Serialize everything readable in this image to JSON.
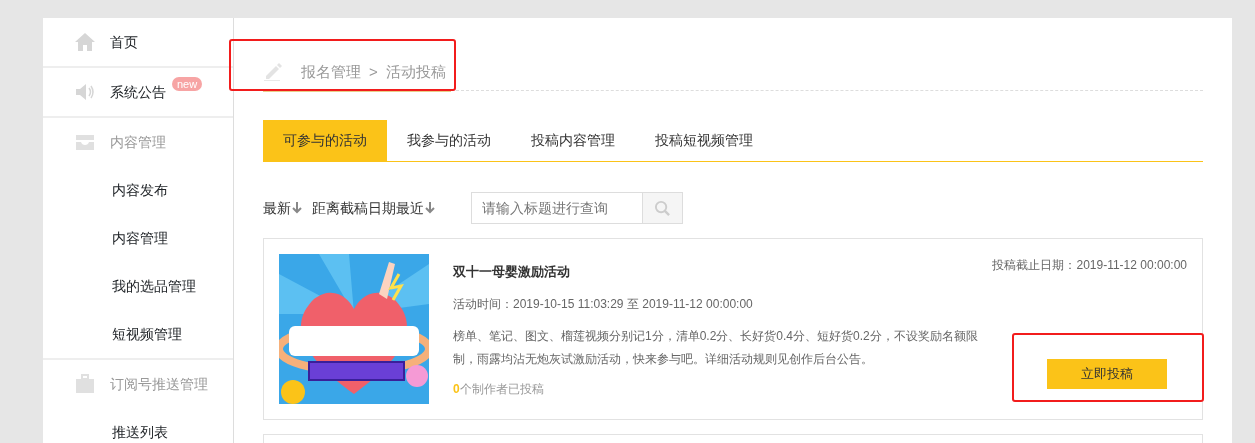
{
  "sidebar": {
    "items": [
      {
        "kind": "link",
        "label": "首页"
      },
      {
        "kind": "link",
        "label": "系统公告",
        "badge": "new"
      },
      {
        "kind": "group",
        "label": "内容管理",
        "children": [
          {
            "label": "内容发布"
          },
          {
            "label": "内容管理"
          },
          {
            "label": "我的选品管理"
          },
          {
            "label": "短视频管理"
          }
        ]
      },
      {
        "kind": "group",
        "label": "订阅号推送管理",
        "children": [
          {
            "label": "推送列表"
          }
        ]
      }
    ]
  },
  "breadcrumb": {
    "items": [
      "报名管理",
      "活动投稿"
    ],
    "separator": ">",
    "highlighted": true
  },
  "tabs": [
    {
      "label": "可参与的活动",
      "selected": true
    },
    {
      "label": "我参与的活动",
      "selected": false
    },
    {
      "label": "投稿内容管理",
      "selected": false
    },
    {
      "label": "投稿短视频管理",
      "selected": false
    }
  ],
  "sort_options": [
    {
      "label": "最新"
    },
    {
      "label": "距离截稿日期最近"
    }
  ],
  "search": {
    "placeholder": "请输入标题进行查询"
  },
  "activities": [
    {
      "title": "双十一母婴激励活动",
      "deadline": "投稿截止日期：2019-11-12 00:00:00",
      "period": "活动时间：2019-10-15 11:03:29 至 2019-11-12 00:00:00",
      "description": "榜单、笔记、图文、榴莲视频分别记1分，清单0.2分、长好货0.4分、短好货0.2分，不设奖励名额限制，雨露均沾无炮灰试激励活动，快来参与吧。详细活动规则见创作后台公告。",
      "count": "0",
      "count_label": "个制作者已投稿",
      "button": "立即投稿",
      "button_highlighted": true
    }
  ]
}
